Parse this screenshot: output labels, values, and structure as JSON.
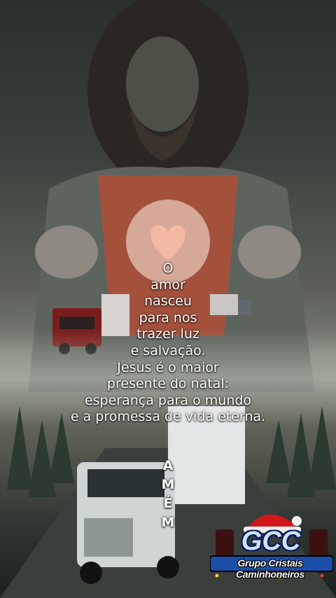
{
  "poem": {
    "lines": [
      "O",
      "amor",
      "nasceu",
      "para nos",
      "trazer luz",
      "e salvação.",
      "Jesus é o maior",
      "presente do natal:",
      "esperança para o mundo",
      "e a promessa de vida eterna."
    ],
    "closing_letters": [
      "A",
      "M",
      "É",
      "M"
    ]
  },
  "logo": {
    "mark": "GCC",
    "name": "Grupo Cristais Caminhoneiros"
  },
  "colors": {
    "text": "#ffffff",
    "glow": "#ffe6d2",
    "heart": "#f4b9a4",
    "truck_red": "#8a2020",
    "truck_white": "#dfe3e3",
    "santa_hat": "#d01818"
  }
}
